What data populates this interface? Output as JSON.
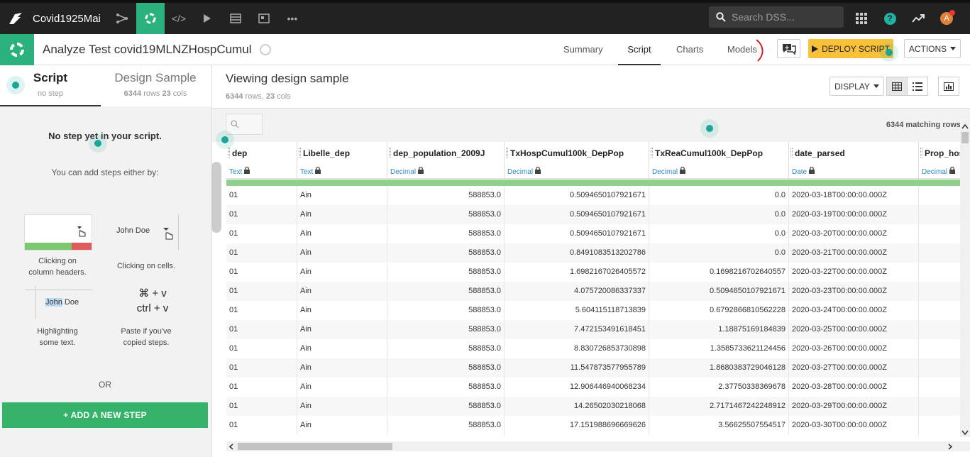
{
  "topbar": {
    "project_name": "Covid1925Mai",
    "search_placeholder": "Search DSS...",
    "avatar_letter": "A"
  },
  "header": {
    "title": "Analyze Test covid19MLNZHospCumul",
    "tabs": [
      "Summary",
      "Script",
      "Charts",
      "Models"
    ],
    "active_tab": "Script",
    "deploy_label": "DEPLOY SCRIPT",
    "actions_label": "ACTIONS"
  },
  "left": {
    "tab_script": "Script",
    "tab_script_sub": "no step",
    "tab_sample": "Design Sample",
    "tab_sample_rows": "6344",
    "tab_sample_rows_label": "rows",
    "tab_sample_cols": "23",
    "tab_sample_cols_label": "cols",
    "no_steps": "No step yet in your script.",
    "can_add": "You can add steps either by:",
    "help1_caption_line1": "Clicking on",
    "help1_caption_line2": "column headers.",
    "help2_name": "John Doe",
    "help2_caption": "Clicking on cells.",
    "help3_john": "John",
    "help3_doe": " Doe",
    "help3_caption_line1": "Highlighting",
    "help3_caption_line2": "some text.",
    "help4_line1": "⌘ + v",
    "help4_line2": "ctrl + v",
    "help4_caption_line1": "Paste if you've",
    "help4_caption_line2": "copied steps.",
    "or_label": "OR",
    "add_step": "+ ADD A NEW STEP"
  },
  "main": {
    "viewing": "Viewing design sample",
    "rows_count": "6344",
    "rows_label": "rows,",
    "cols_count": "23",
    "cols_label": "cols",
    "display_label": "DISPLAY",
    "matching_rows": "6344 matching rows"
  },
  "table": {
    "columns": [
      {
        "name": "dep",
        "type": "Text"
      },
      {
        "name": "Libelle_dep",
        "type": "Text"
      },
      {
        "name": "dep_population_2009J",
        "type": "Decimal"
      },
      {
        "name": "TxHospCumul100k_DepPop",
        "type": "Decimal"
      },
      {
        "name": "TxReaCumul100k_DepPop",
        "type": "Decimal"
      },
      {
        "name": "date_parsed",
        "type": "Date"
      },
      {
        "name": "Prop_hos",
        "type": "Decimal"
      }
    ],
    "rows": [
      [
        "01",
        "Ain",
        "588853.0",
        "0.5094650107921671",
        "0.0",
        "2020-03-18T00:00:00.000Z",
        ""
      ],
      [
        "01",
        "Ain",
        "588853.0",
        "0.5094650107921671",
        "0.0",
        "2020-03-19T00:00:00.000Z",
        ""
      ],
      [
        "01",
        "Ain",
        "588853.0",
        "0.5094650107921671",
        "0.0",
        "2020-03-20T00:00:00.000Z",
        ""
      ],
      [
        "01",
        "Ain",
        "588853.0",
        "0.8491083513202786",
        "0.0",
        "2020-03-21T00:00:00.000Z",
        ""
      ],
      [
        "01",
        "Ain",
        "588853.0",
        "1.6982167026405572",
        "0.1698216702640557",
        "2020-03-22T00:00:00.000Z",
        ""
      ],
      [
        "01",
        "Ain",
        "588853.0",
        "4.075720086337337",
        "0.5094650107921671",
        "2020-03-23T00:00:00.000Z",
        ""
      ],
      [
        "01",
        "Ain",
        "588853.0",
        "5.604115118713839",
        "0.6792866810562228",
        "2020-03-24T00:00:00.000Z",
        ""
      ],
      [
        "01",
        "Ain",
        "588853.0",
        "7.472153491618451",
        "1.18875169184839",
        "2020-03-25T00:00:00.000Z",
        ""
      ],
      [
        "01",
        "Ain",
        "588853.0",
        "8.830726853730898",
        "1.3585733621124456",
        "2020-03-26T00:00:00.000Z",
        ""
      ],
      [
        "01",
        "Ain",
        "588853.0",
        "11.547873577955789",
        "1.8680383729046128",
        "2020-03-27T00:00:00.000Z",
        ""
      ],
      [
        "01",
        "Ain",
        "588853.0",
        "12.906446940068234",
        "2.37750338369678",
        "2020-03-28T00:00:00.000Z",
        ""
      ],
      [
        "01",
        "Ain",
        "588853.0",
        "14.26502030218068",
        "2.7171467242248912",
        "2020-03-29T00:00:00.000Z",
        ""
      ],
      [
        "01",
        "Ain",
        "588853.0",
        "17.151988696669626",
        "3.56625507554517",
        "2020-03-30T00:00:00.000Z",
        ""
      ]
    ]
  }
}
